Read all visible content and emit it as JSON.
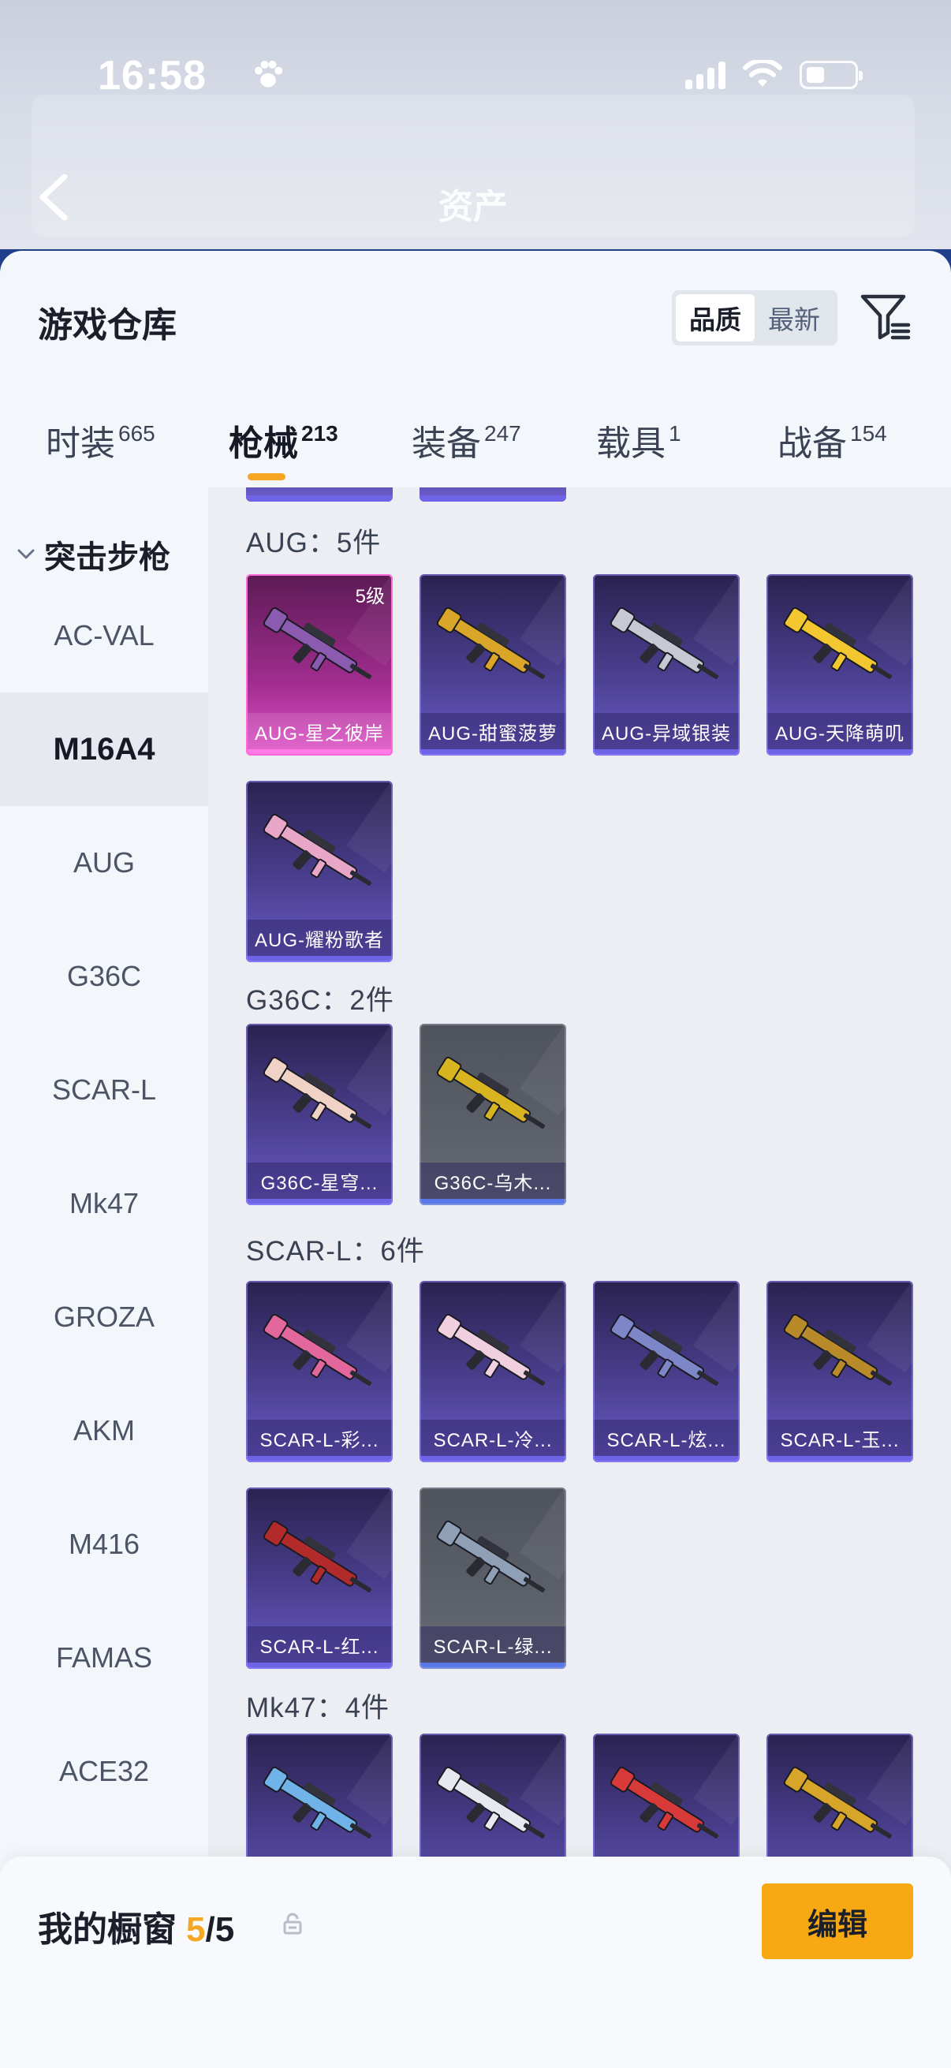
{
  "status_bar": {
    "time": "16:58"
  },
  "header": {
    "title": "资产"
  },
  "sheet": {
    "title": "游戏仓库",
    "sort_options": [
      {
        "label": "品质",
        "active": true
      },
      {
        "label": "最新",
        "active": false
      }
    ]
  },
  "tabs": [
    {
      "label": "时装",
      "count": "665",
      "active": false
    },
    {
      "label": "枪械",
      "count": "213",
      "active": true
    },
    {
      "label": "装备",
      "count": "247",
      "active": false
    },
    {
      "label": "载具",
      "count": "1",
      "active": false
    },
    {
      "label": "战备",
      "count": "154",
      "active": false
    }
  ],
  "sidebar": {
    "category": "突击步枪",
    "items": [
      "AC-VAL",
      "M16A4",
      "AUG",
      "G36C",
      "SCAR-L",
      "Mk47",
      "GROZA",
      "AKM",
      "M416",
      "FAMAS",
      "ACE32"
    ],
    "active_item": "M16A4"
  },
  "groups": [
    {
      "title": "AUG：5件",
      "items": [
        {
          "label": "AUG-星之彼岸",
          "level": "5级",
          "rarity": "pink",
          "gun_color": "#8a5bb0"
        },
        {
          "label": "AUG-甜蜜菠萝",
          "level": "",
          "rarity": "purple",
          "gun_color": "#d9a62a"
        },
        {
          "label": "AUG-异域银装",
          "level": "",
          "rarity": "purple",
          "gun_color": "#c6c9d4"
        },
        {
          "label": "AUG-天降萌叽",
          "level": "",
          "rarity": "purple",
          "gun_color": "#f2c730"
        },
        {
          "label": "AUG-耀粉歌者",
          "level": "",
          "rarity": "purple",
          "gun_color": "#e9a7c7"
        }
      ]
    },
    {
      "title": "G36C：2件",
      "items": [
        {
          "label": "G36C-星穹...",
          "level": "",
          "rarity": "purple",
          "gun_color": "#f0d2c6"
        },
        {
          "label": "G36C-乌木...",
          "level": "",
          "rarity": "grey",
          "gun_color": "#d8b520"
        }
      ]
    },
    {
      "title": "SCAR-L：6件",
      "items": [
        {
          "label": "SCAR-L-彩...",
          "level": "",
          "rarity": "purple",
          "gun_color": "#e2679a"
        },
        {
          "label": "SCAR-L-冷...",
          "level": "",
          "rarity": "purple",
          "gun_color": "#f0d0de"
        },
        {
          "label": "SCAR-L-炫...",
          "level": "",
          "rarity": "purple",
          "gun_color": "#7d86c7"
        },
        {
          "label": "SCAR-L-玉...",
          "level": "",
          "rarity": "purple",
          "gun_color": "#b88a2a"
        },
        {
          "label": "SCAR-L-红...",
          "level": "",
          "rarity": "purple",
          "gun_color": "#b22a2a"
        },
        {
          "label": "SCAR-L-绿...",
          "level": "",
          "rarity": "grey",
          "gun_color": "#8fa0b6"
        }
      ]
    },
    {
      "title": "Mk47：4件",
      "items": [
        {
          "label": "",
          "level": "",
          "rarity": "purple",
          "gun_color": "#6fb3e8"
        },
        {
          "label": "",
          "level": "",
          "rarity": "purple",
          "gun_color": "#e8e8f0"
        },
        {
          "label": "",
          "level": "",
          "rarity": "purple",
          "gun_color": "#d83a3a"
        },
        {
          "label": "",
          "level": "",
          "rarity": "purple",
          "gun_color": "#d6a52a"
        }
      ]
    }
  ],
  "showcase": {
    "label": "我的橱窗",
    "count": "5",
    "separator": "/",
    "total": "5"
  },
  "edit_button": {
    "label": "编辑"
  },
  "colors": {
    "accent": "#f6a912",
    "tab_underline": "#f5a623"
  }
}
